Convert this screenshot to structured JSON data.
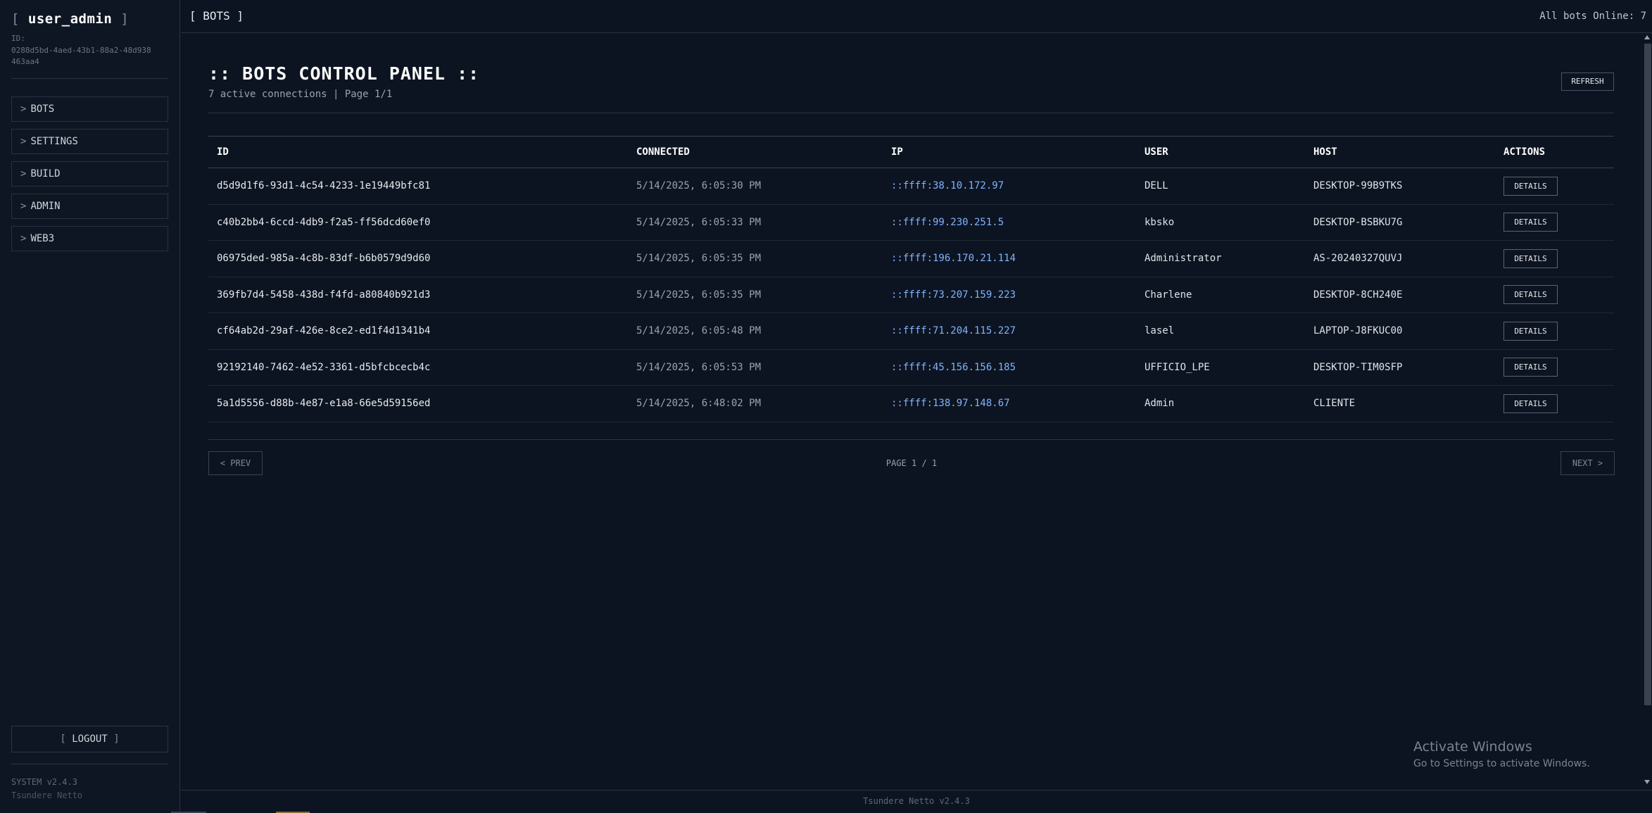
{
  "sidebar": {
    "user_name": "user_admin",
    "open_bracket": "[",
    "close_bracket": "]",
    "id_label": "ID:",
    "user_id": "0288d5bd-4aed-43b1-88a2-48d938463aa4",
    "nav": [
      {
        "caret": ">",
        "label": "BOTS"
      },
      {
        "caret": ">",
        "label": "SETTINGS"
      },
      {
        "caret": ">",
        "label": "BUILD"
      },
      {
        "caret": ">",
        "label": "ADMIN"
      },
      {
        "caret": ">",
        "label": "WEB3"
      }
    ],
    "logout_label": "LOGOUT",
    "system_version": "SYSTEM v2.4.3",
    "system_name": "Tsundere Netto"
  },
  "topbar": {
    "title": "[ BOTS ]",
    "status": "All bots Online: 7"
  },
  "main": {
    "panel_title": ":: BOTS CONTROL PANEL ::",
    "panel_subtitle": "7 active connections | Page 1/1",
    "refresh_label": "REFRESH",
    "table": {
      "headers": [
        "ID",
        "CONNECTED",
        "IP",
        "USER",
        "HOST",
        "ACTIONS"
      ],
      "rows": [
        {
          "id": "d5d9d1f6-93d1-4c54-4233-1e19449bfc81",
          "connected": "5/14/2025, 6:05:30 PM",
          "ip": "::ffff:38.10.172.97",
          "user": "DELL",
          "host": "DESKTOP-99B9TKS",
          "action": "DETAILS"
        },
        {
          "id": "c40b2bb4-6ccd-4db9-f2a5-ff56dcd60ef0",
          "connected": "5/14/2025, 6:05:33 PM",
          "ip": "::ffff:99.230.251.5",
          "user": "kbsko",
          "host": "DESKTOP-BSBKU7G",
          "action": "DETAILS"
        },
        {
          "id": "06975ded-985a-4c8b-83df-b6b0579d9d60",
          "connected": "5/14/2025, 6:05:35 PM",
          "ip": "::ffff:196.170.21.114",
          "user": "Administrator",
          "host": "AS-20240327QUVJ",
          "action": "DETAILS"
        },
        {
          "id": "369fb7d4-5458-438d-f4fd-a80840b921d3",
          "connected": "5/14/2025, 6:05:35 PM",
          "ip": "::ffff:73.207.159.223",
          "user": "Charlene",
          "host": "DESKTOP-8CH240E",
          "action": "DETAILS"
        },
        {
          "id": "cf64ab2d-29af-426e-8ce2-ed1f4d1341b4",
          "connected": "5/14/2025, 6:05:48 PM",
          "ip": "::ffff:71.204.115.227",
          "user": "lasel",
          "host": "LAPTOP-J8FKUC00",
          "action": "DETAILS"
        },
        {
          "id": "92192140-7462-4e52-3361-d5bfcbcecb4c",
          "connected": "5/14/2025, 6:05:53 PM",
          "ip": "::ffff:45.156.156.185",
          "user": "UFFICIO_LPE",
          "host": "DESKTOP-TIM0SFP",
          "action": "DETAILS"
        },
        {
          "id": "5a1d5556-d88b-4e87-e1a8-66e5d59156ed",
          "connected": "5/14/2025, 6:48:02 PM",
          "ip": "::ffff:138.97.148.67",
          "user": "Admin",
          "host": "CLIENTE",
          "action": "DETAILS"
        }
      ]
    },
    "pagination": {
      "prev_label": "< PREV",
      "page_label": "PAGE 1 / 1",
      "next_label": "NEXT >"
    }
  },
  "watermark": {
    "title": "Activate Windows",
    "subtitle": "Go to Settings to activate Windows."
  },
  "footer": {
    "text": "Tsundere Netto v2.4.3"
  }
}
